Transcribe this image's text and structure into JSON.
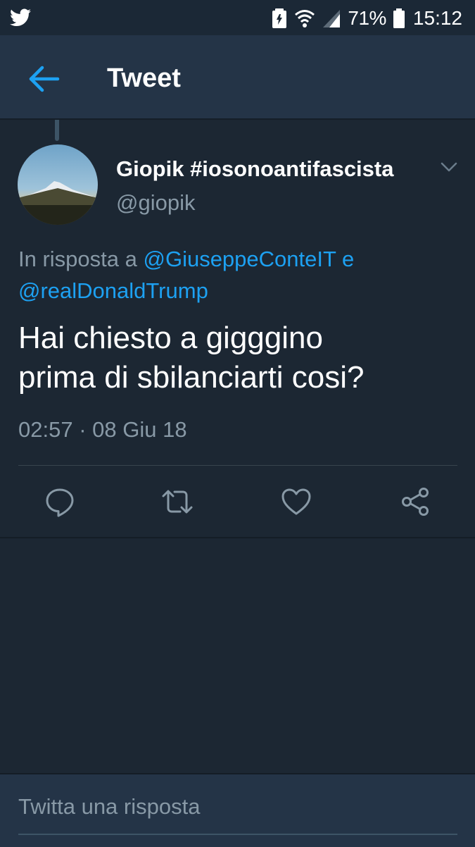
{
  "status_bar": {
    "battery_percent": "71%",
    "time": "15:12"
  },
  "app_bar": {
    "title": "Tweet"
  },
  "tweet": {
    "display_name": "Giopik #iosonoantifascista",
    "handle": "@giopik",
    "reply_prefix": "In risposta a ",
    "mention_1": "@GiuseppeConteIT",
    "reply_join": " e",
    "mention_2": "@realDonaldTrump",
    "text_line_1": "Hai chiesto a gigggino",
    "text_line_2": "prima di sbilanciarti cosi?",
    "timestamp": "02:57 · 08 Giu 18"
  },
  "composer": {
    "placeholder": "Twitta una risposta"
  },
  "colors": {
    "background": "#1c2733",
    "bar": "#243447",
    "accent": "#1da1f2",
    "secondary_text": "#8899a6"
  },
  "icons": {
    "status_app": "twitter-bird-icon",
    "back": "arrow-left-icon",
    "menu": "chevron-down-icon",
    "reply": "reply-bubble-icon",
    "retweet": "retweet-icon",
    "like": "heart-icon",
    "share": "share-icon"
  }
}
